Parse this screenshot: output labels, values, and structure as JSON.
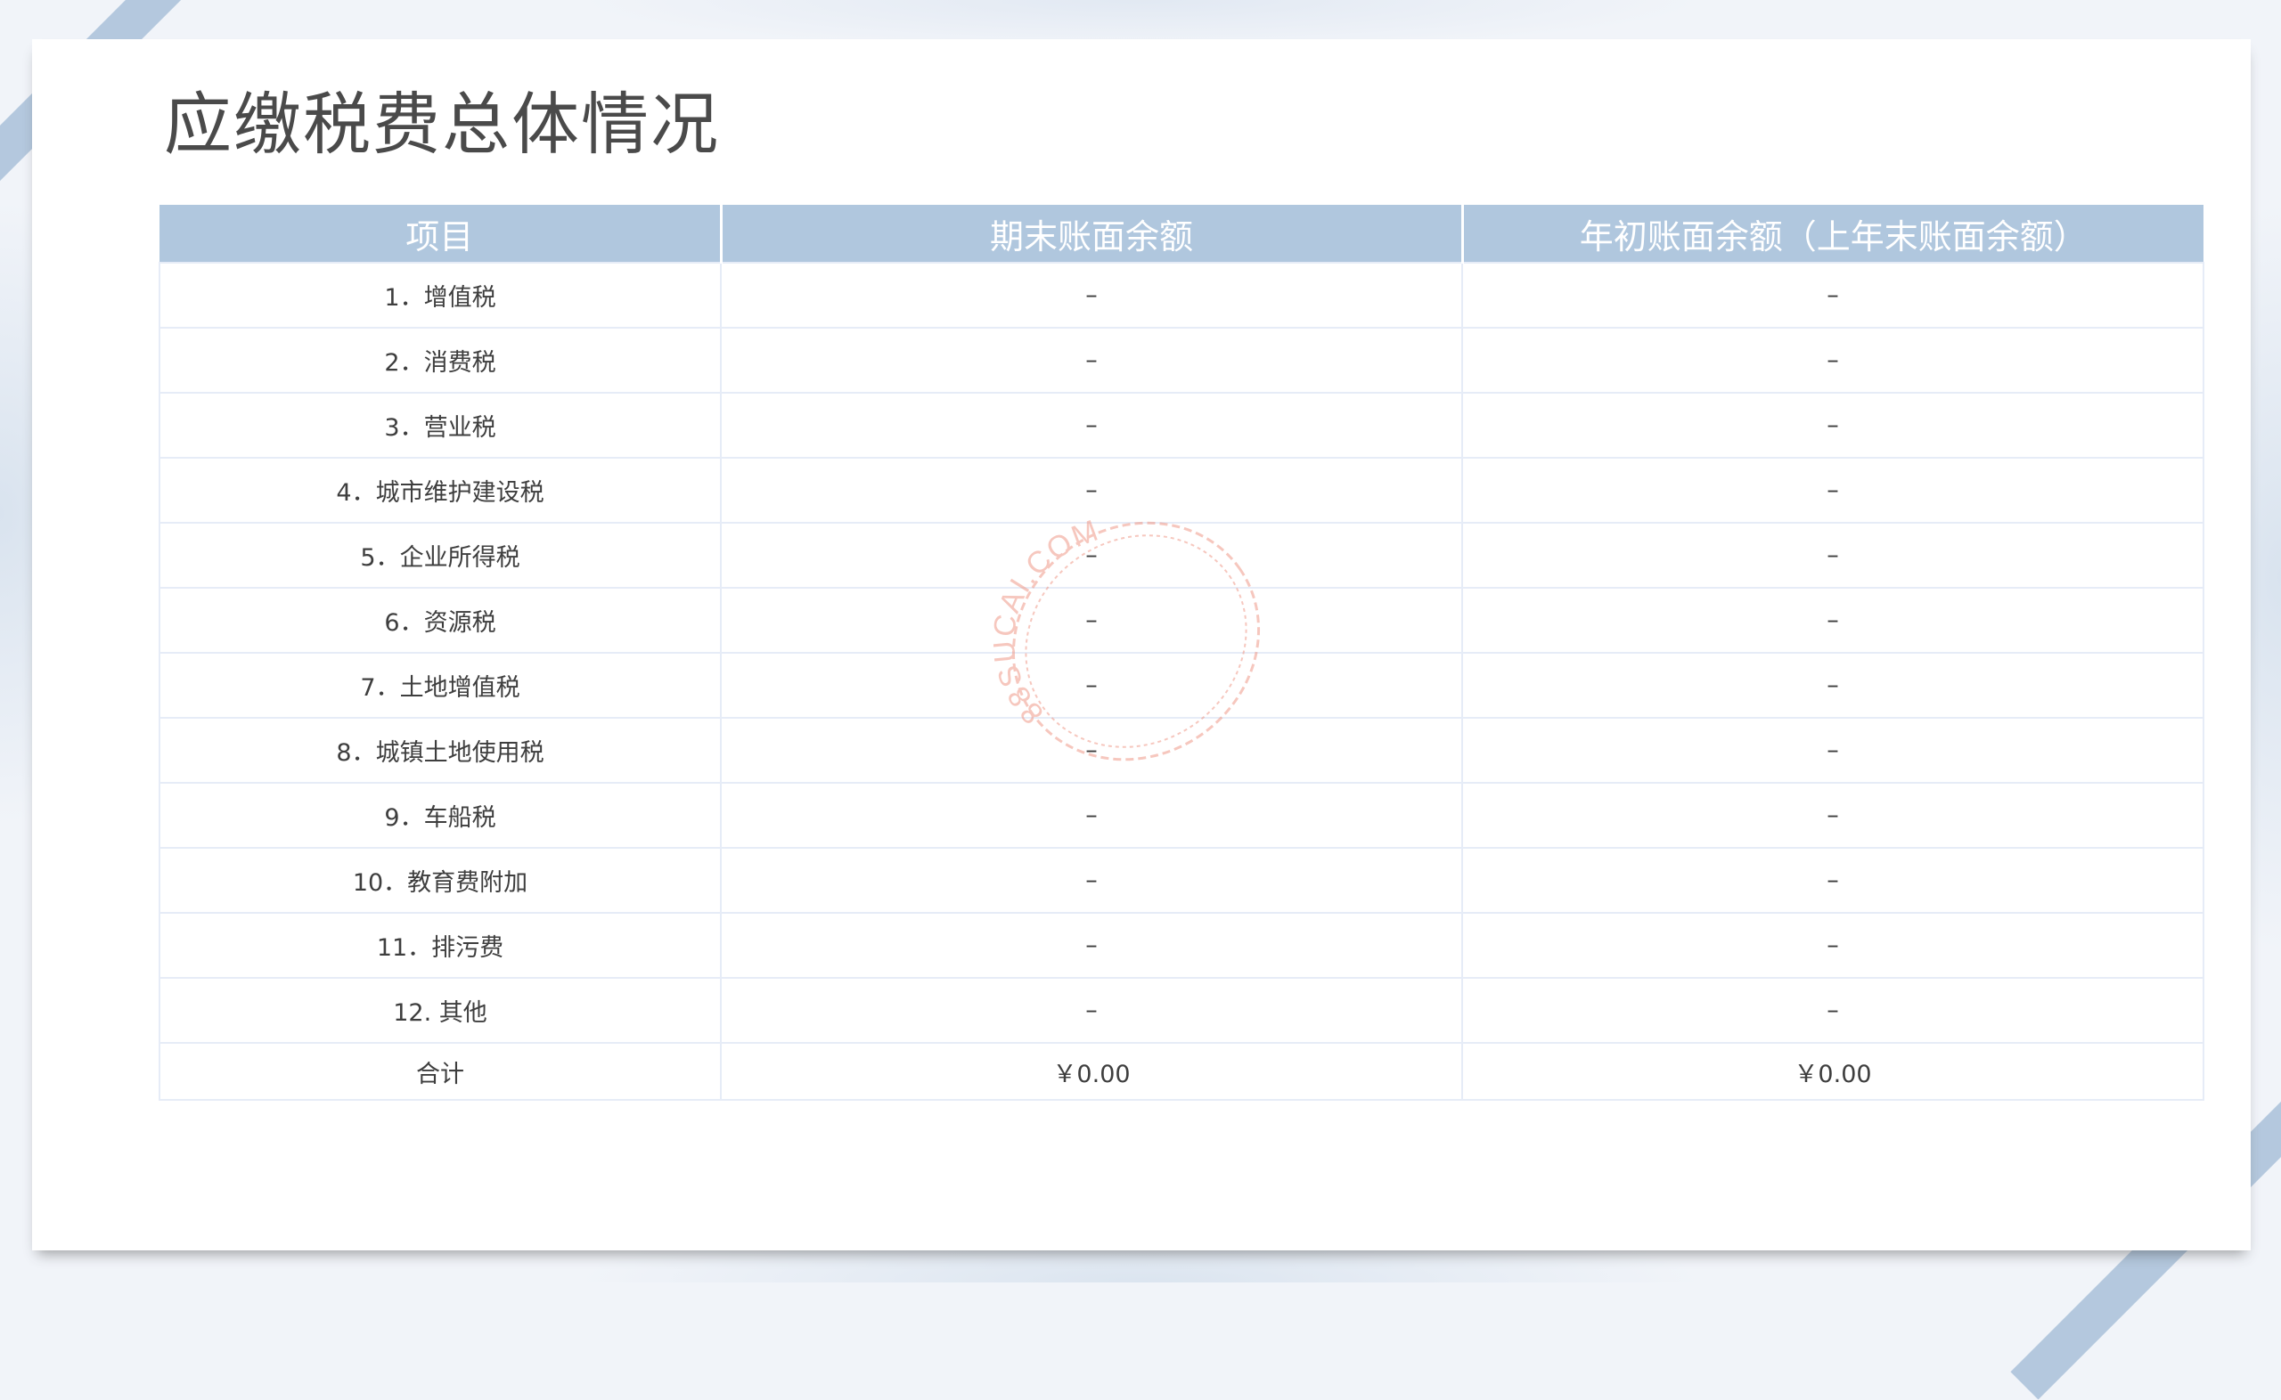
{
  "title": "应缴税费总体情况",
  "table": {
    "headers": [
      "项目",
      "期末账面余额",
      "年初账面余额（上年末账面余额）"
    ],
    "rows": [
      [
        "1．增值税",
        "–",
        "–"
      ],
      [
        "2．消费税",
        "–",
        "–"
      ],
      [
        "3．营业税",
        "–",
        "–"
      ],
      [
        "4．城市维护建设税",
        "–",
        "–"
      ],
      [
        "5．企业所得税",
        "–",
        "–"
      ],
      [
        "6．资源税",
        "–",
        "–"
      ],
      [
        "7．土地增值税",
        "–",
        "–"
      ],
      [
        "8．城镇土地使用税",
        "–",
        "–"
      ],
      [
        "9．车船税",
        "–",
        "–"
      ],
      [
        "10．教育费附加",
        "–",
        "–"
      ],
      [
        "11．排污费",
        "–",
        "–"
      ],
      [
        "12. 其他",
        "–",
        "–"
      ]
    ],
    "total": [
      "合计",
      "￥0.00",
      "￥0.00"
    ]
  },
  "watermark": {
    "text": "88SUCAI.COM",
    "color": "#f09a8a"
  },
  "colors": {
    "header_bg": "#b0c7de",
    "ribbon": "#a9c0d9",
    "title": "#4a4a4a"
  }
}
